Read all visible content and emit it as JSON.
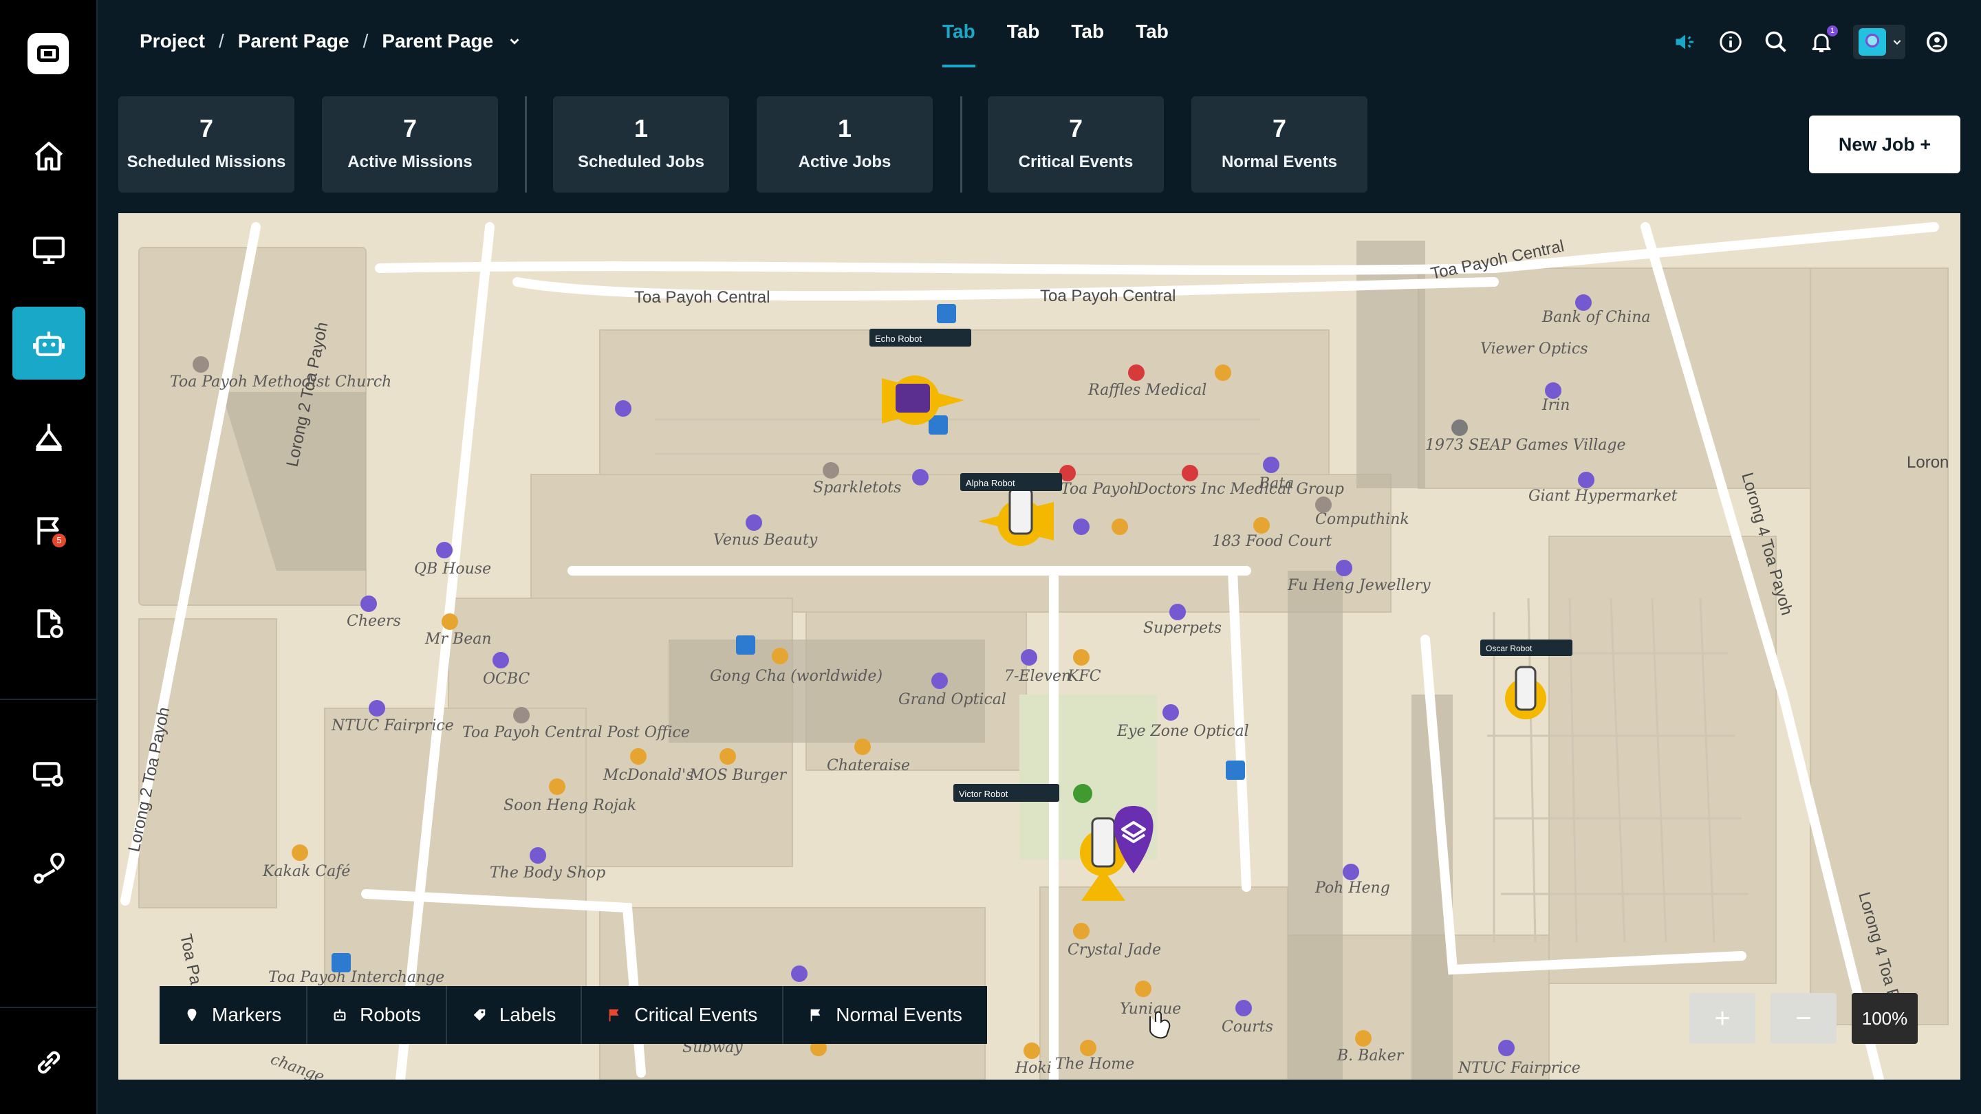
{
  "breadcrumb": {
    "items": [
      "Project",
      "Parent Page",
      "Parent Page"
    ],
    "sep": "/"
  },
  "tabs": [
    "Tab",
    "Tab",
    "Tab",
    "Tab"
  ],
  "header_icons": [
    "mute-icon",
    "info-icon",
    "search-icon",
    "bell-icon",
    "avatar",
    "user-icon"
  ],
  "notifications": {
    "count": "1"
  },
  "sidebar": {
    "items": [
      "home-icon",
      "monitor-icon",
      "robot-icon",
      "tripod-icon",
      "flag-icon",
      "document-icon",
      "desktop-settings-icon",
      "route-icon",
      "link-icon"
    ],
    "active": "robot-icon",
    "flag_badge": "5"
  },
  "stats": [
    {
      "value": "7",
      "label": "Scheduled Missions"
    },
    {
      "value": "7",
      "label": "Active Missions"
    },
    {
      "value": "1",
      "label": "Scheduled Jobs"
    },
    {
      "value": "1",
      "label": "Active Jobs"
    },
    {
      "value": "7",
      "label": "Critical Events"
    },
    {
      "value": "7",
      "label": "Normal Events"
    }
  ],
  "new_job_label": "New Job +",
  "map": {
    "roads": [
      "Toa Payoh Central",
      "Toa Payoh Central",
      "Toa Payoh Central",
      "Lorong 2 Toa Payoh",
      "Lorong 2 Toa Payoh",
      "Lorong 4 Toa Payoh",
      "Lorong 4 Toa Payoh",
      "Loron",
      "Toa Pa"
    ],
    "pois": [
      "Toa Payoh Methodist Church",
      "Raffles Medical",
      "Bank of China",
      "Viewer Optics",
      "Irin",
      "1973 SEAP Games Village",
      "Giant Hypermarket",
      "Sparkletots",
      "Toa Payoh",
      "Doctors Inc Medical Group",
      "Bata",
      "Computhink",
      "Venus Beauty",
      "183 Food Court",
      "QB House",
      "Fu Heng Jewellery",
      "Cheers",
      "Mr Bean",
      "OCBC",
      "Gong Cha (worldwide)",
      "Superpets",
      "7-Eleven",
      "KFC",
      "Grand Optical",
      "NTUC Fairprice",
      "Toa Payoh Central Post Office",
      "McDonald's",
      "MOS Burger",
      "Chateraise",
      "Eye Zone Optical",
      "Soon Heng Rojak",
      "Kakak Café",
      "The Body Shop",
      "Poh Heng",
      "Crystal Jade",
      "Toa Payoh Interchange",
      "Yunique",
      "Courts",
      "Hoki",
      "The Home",
      "B. Baker",
      "NTUC Fairprice",
      "change",
      "Subway"
    ],
    "robots": [
      "Echo Robot",
      "Alpha Robot",
      "Victor Robot",
      "Oscar Robot"
    ],
    "colors": {
      "cone": "#f5b800",
      "pin": "#6a2fb0"
    }
  },
  "layers": [
    {
      "icon": "marker-icon",
      "label": "Markers"
    },
    {
      "icon": "robot-icon",
      "label": "Robots"
    },
    {
      "icon": "tag-icon",
      "label": "Labels"
    },
    {
      "icon": "critical-flag-icon",
      "label": "Critical Events"
    },
    {
      "icon": "flag-icon",
      "label": "Normal Events"
    }
  ],
  "zoom": {
    "in": "+",
    "out": "−",
    "level": "100%"
  }
}
